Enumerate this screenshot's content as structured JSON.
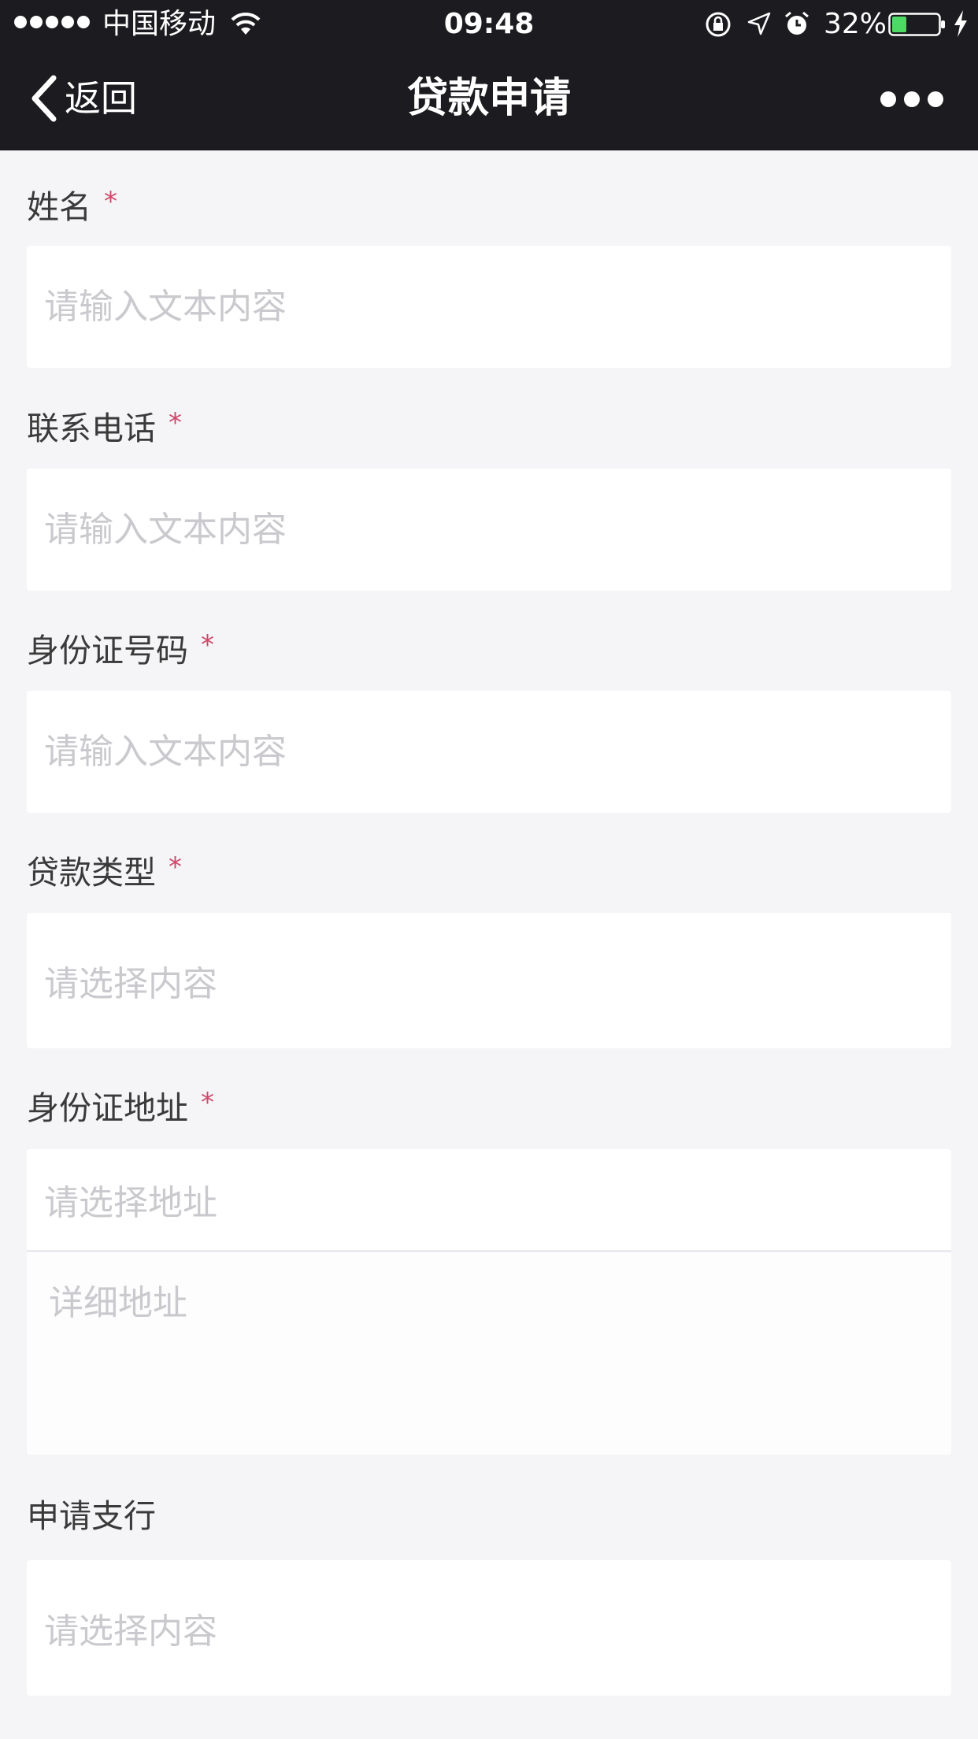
{
  "status_bar": {
    "carrier": "中国移动",
    "time": "09:48",
    "battery_percent": "32%",
    "battery_level": 0.32,
    "battery_color": "#4cd964",
    "icons": [
      "signal-dots",
      "wifi-icon",
      "rotation-lock-icon",
      "location-icon",
      "alarm-icon",
      "battery-icon",
      "charging-icon"
    ]
  },
  "nav": {
    "back_label": "返回",
    "title": "贷款申请",
    "more_icon": "more-dots-icon"
  },
  "form": {
    "required_mark": "*",
    "required_color": "#d0486a",
    "name": {
      "label": "姓名",
      "placeholder": "请输入文本内容"
    },
    "phone": {
      "label": "联系电话",
      "placeholder": "请输入文本内容"
    },
    "id_number": {
      "label": "身份证号码",
      "placeholder": "请输入文本内容"
    },
    "loan_type": {
      "label": "贷款类型",
      "placeholder": "请选择内容"
    },
    "id_address": {
      "label": "身份证地址",
      "select_placeholder": "请选择地址",
      "detail_placeholder": "详细地址"
    },
    "branch": {
      "label": "申请支行",
      "placeholder": "请选择内容"
    }
  }
}
